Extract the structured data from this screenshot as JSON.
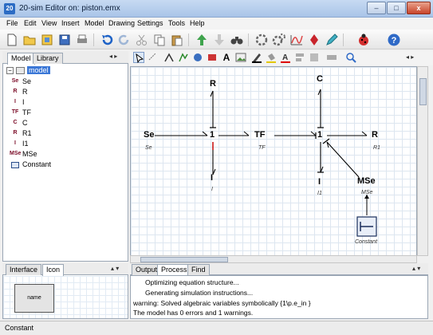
{
  "window": {
    "title": "20-sim Editor on: piston.emx",
    "app_icon": "20"
  },
  "menu": [
    {
      "label": "File"
    },
    {
      "label": "Edit"
    },
    {
      "label": "View"
    },
    {
      "label": "Insert"
    },
    {
      "label": "Model"
    },
    {
      "label": "Drawing"
    },
    {
      "label": "Settings"
    },
    {
      "label": "Tools"
    },
    {
      "label": "Help"
    }
  ],
  "left_tabs": {
    "model": "Model",
    "library": "Library"
  },
  "tree": {
    "root": "model",
    "items": [
      {
        "icon": "Se",
        "label": "Se"
      },
      {
        "icon": "R",
        "label": "R"
      },
      {
        "icon": "I",
        "label": "I"
      },
      {
        "icon": "TF",
        "label": "TF"
      },
      {
        "icon": "C",
        "label": "C"
      },
      {
        "icon": "R",
        "label": "R1"
      },
      {
        "icon": "I",
        "label": "I1"
      },
      {
        "icon": "MSe",
        "label": "MSe"
      },
      {
        "icon": "constant-icon",
        "label": "Constant"
      }
    ]
  },
  "bottom_left_tabs": {
    "interface": "Interface",
    "icon": "Icon"
  },
  "icon_preview": "name",
  "diagram": {
    "nodes": {
      "Se": {
        "label": "Se",
        "sub": "Se"
      },
      "junction1": {
        "label": "1"
      },
      "R": {
        "label": "R"
      },
      "I": {
        "label": "I",
        "sub": "I"
      },
      "TF": {
        "label": "TF",
        "sub": "TF"
      },
      "junction2": {
        "label": "1"
      },
      "C": {
        "label": "C"
      },
      "R1": {
        "label": "R",
        "sub": "R1"
      },
      "I1": {
        "label": "I",
        "sub": "I1"
      },
      "MSe": {
        "label": "MSe",
        "sub": "MSe"
      },
      "Constant": {
        "sub": "Constant"
      }
    }
  },
  "output_tabs": {
    "output": "Output",
    "process": "Process",
    "find": "Find"
  },
  "output_lines": [
    "Optimizing equation structure...",
    "Generating simulation instructions...",
    "warning: Solved algebraic variables symbolically {1\\p.e_in }",
    "The model has 0 errors and 1 warnings."
  ],
  "status": "Constant",
  "colors": {
    "accent": "#3b77d6",
    "titlebar": "#b8cfee",
    "bond": "#000000",
    "selection_bond": "#cc0000"
  }
}
